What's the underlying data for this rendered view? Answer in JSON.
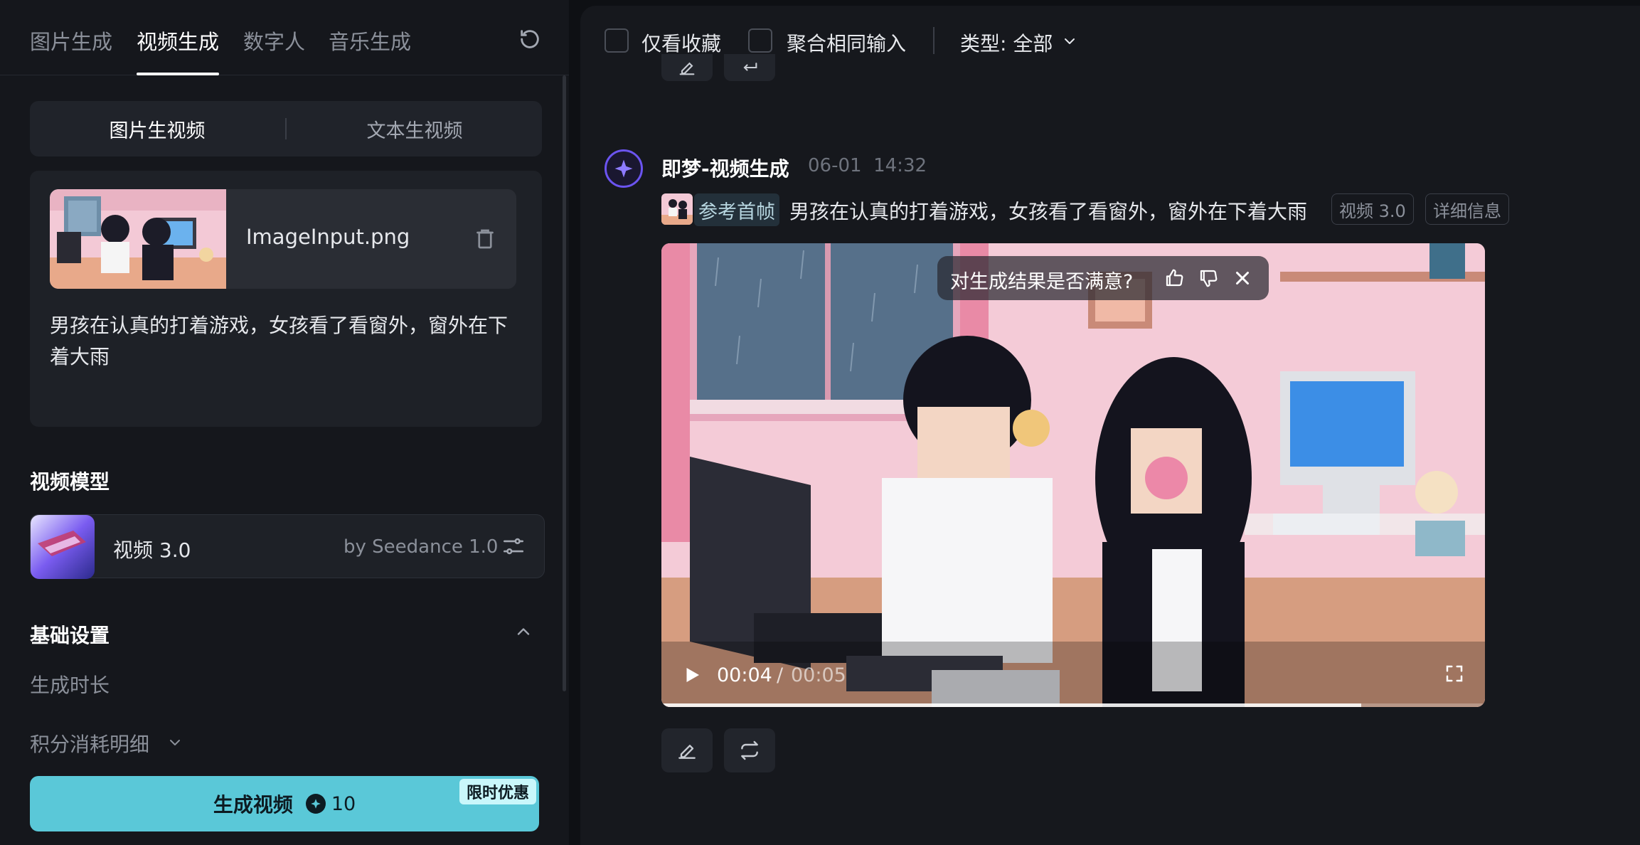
{
  "left": {
    "tabs": [
      "图片生成",
      "视频生成",
      "数字人",
      "音乐生成"
    ],
    "active_tab": "视频生成",
    "mode_tabs": [
      "图片生视频",
      "文本生视频"
    ],
    "active_mode": "图片生视频",
    "file_name": "ImageInput.png",
    "prompt_text": "男孩在认真的打着游戏，女孩看了看窗外，窗外在下着大雨",
    "model_section_title": "视频模型",
    "model_name": "视频 3.0",
    "model_by": "by Seedance 1.0",
    "basic_settings_title": "基础设置",
    "duration_label": "生成时长",
    "credit_label": "积分消耗明细",
    "generate_label": "生成视频",
    "generate_cost": "10",
    "promo_badge": "限时优惠"
  },
  "right": {
    "filters": {
      "favorites_label": "仅看收藏",
      "merge_label": "聚合相同输入",
      "type_label": "类型: 全部"
    },
    "message": {
      "sender": "即梦-视频生成",
      "date": "06-01",
      "time": "14:32",
      "ref_tag": "参考首帧",
      "prompt": "男孩在认真的打着游戏，女孩看了看窗外，窗外在下着大雨",
      "tags": [
        "视频 3.0",
        "详细信息"
      ]
    },
    "video": {
      "feedback_question": "对生成结果是否满意?",
      "current_time": "00:04",
      "separator": "/",
      "total_time": "00:05",
      "progress": 0.85
    }
  },
  "colors": {
    "accent": "#5ac8d8",
    "avatar_ring": "#6b54f0",
    "panel_bg": "#15171c"
  }
}
